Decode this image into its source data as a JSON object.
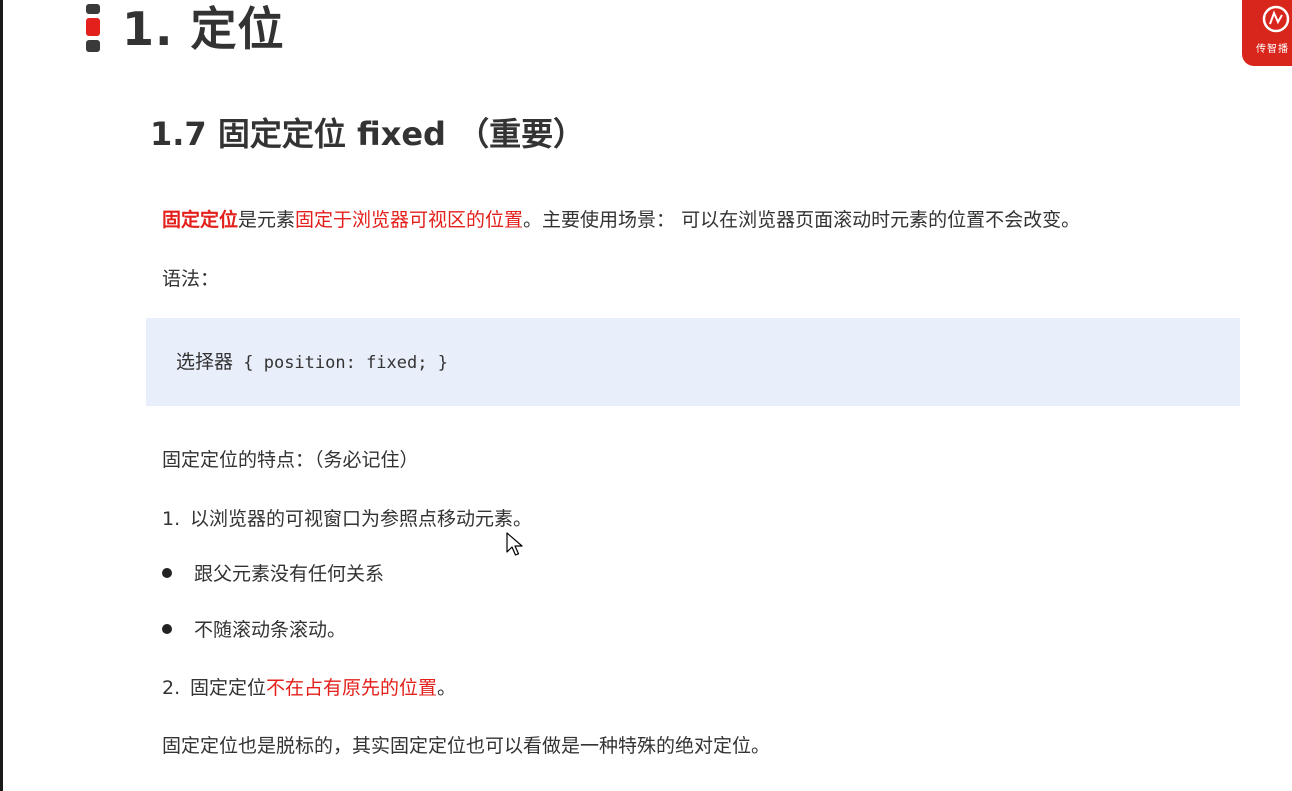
{
  "chapter": {
    "title": "1. 定位"
  },
  "logo": {
    "text": "传智播"
  },
  "section": {
    "title": "1.7 固定定位 fixed （重要）"
  },
  "intro": {
    "term": "固定定位",
    "text1": "是元素",
    "highlight": "固定于浏览器可视区的位置",
    "text2": "。主要使用场景： 可以在浏览器页面滚动时元素的位置不会改变。"
  },
  "syntax": {
    "label": "语法："
  },
  "code": {
    "selector": "选择器",
    "body": " { position: fixed; }"
  },
  "features": {
    "heading": "固定定位的特点：（务必记住）",
    "item1_num": "1.",
    "item1_text": "以浏览器的可视窗口为参照点移动元素。",
    "bullet1": "跟父元素没有任何关系",
    "bullet2": "不随滚动条滚动。",
    "item2_num": "2.",
    "item2_text": "固定定位",
    "item2_highlight": "不在占有原先的位置",
    "item2_end": "。",
    "note": "固定定位也是脱标的，其实固定定位也可以看做是一种特殊的绝对定位。"
  },
  "colors": {
    "accent": "#e3201b",
    "code_bg": "#e8eefa",
    "text": "#333333"
  }
}
